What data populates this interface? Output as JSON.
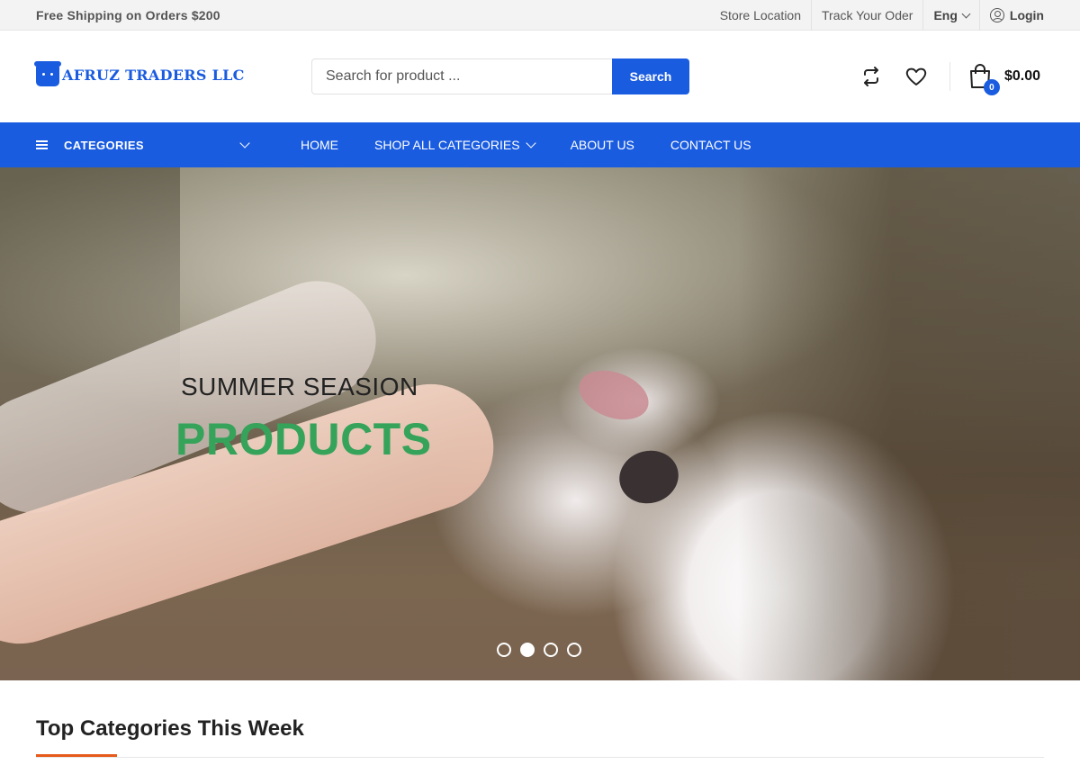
{
  "topbar": {
    "shipping_text": "Free Shipping on Orders $200",
    "store_location": "Store Location",
    "track_order": "Track Your Oder",
    "language": "Eng",
    "login": "Login"
  },
  "header": {
    "brand": "AFRUZ TRADERS LLC",
    "search_placeholder": "Search for product ...",
    "search_button": "Search",
    "cart_count": "0",
    "cart_total": "$0.00",
    "icons": [
      "compare-icon",
      "wishlist-heart-icon",
      "shopping-bag-icon"
    ]
  },
  "nav": {
    "categories_label": "CATEGORIES",
    "items": [
      {
        "label": "HOME"
      },
      {
        "label": "SHOP ALL CATEGORIES"
      },
      {
        "label": "ABOUT US"
      },
      {
        "label": "CONTACT US"
      }
    ]
  },
  "hero": {
    "pre_title": "SUMMER SEASION",
    "title": "PRODUCTS",
    "slides": 4,
    "active_slide": 2
  },
  "section": {
    "title": "Top Categories This Week"
  },
  "colors": {
    "primary": "#1a5ce0",
    "hero_title": "#35a35a",
    "accent": "#e65a1a"
  }
}
